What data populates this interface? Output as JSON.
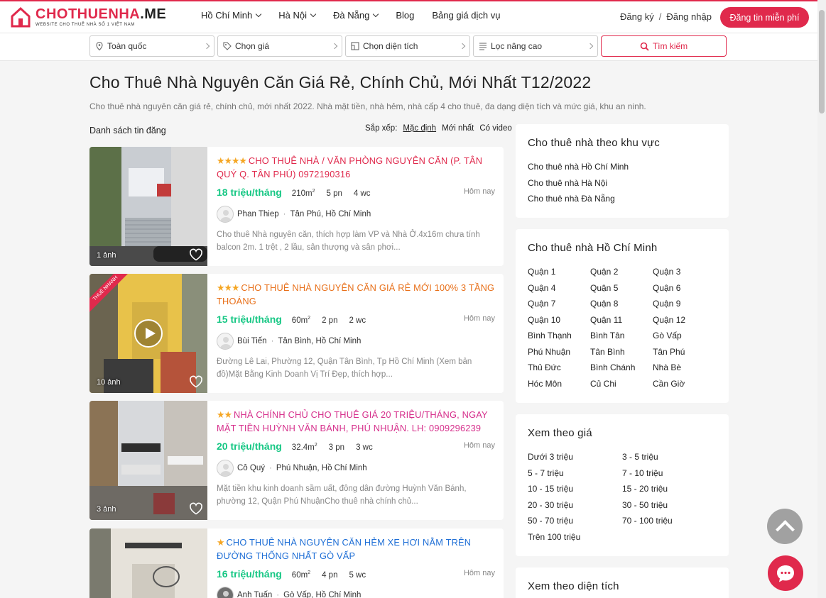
{
  "header": {
    "logo_name_red": "CHOTHUENHA",
    "logo_name_dark": ".ME",
    "logo_tagline": "WEBSITE CHO THUÊ NHÀ SỐ 1 VIỆT NAM",
    "nav": [
      {
        "label": "Hồ Chí Minh",
        "dropdown": true
      },
      {
        "label": "Hà Nội",
        "dropdown": true
      },
      {
        "label": "Đà Nẵng",
        "dropdown": true
      },
      {
        "label": "Blog",
        "dropdown": false
      },
      {
        "label": "Bảng giá dịch vụ",
        "dropdown": false
      }
    ],
    "register": "Đăng ký",
    "separator": "/",
    "login": "Đăng nhập",
    "post_button": "Đăng tin miễn phí",
    "brand_color": "#e0294c"
  },
  "search": {
    "location": "Toàn quốc",
    "price": "Chọn giá",
    "area": "Chọn diện tích",
    "advanced": "Lọc nâng cao",
    "button": "Tìm kiếm"
  },
  "page": {
    "title": "Cho Thuê Nhà Nguyên Căn Giá Rẻ, Chính Chủ, Mới Nhất T12/2022",
    "description": "Cho thuê nhà nguyên căn giá rẻ, chính chủ, mới nhất 2022. Nhà mặt tiền, nhà hẻm, nhà cấp 4 cho thuê, đa dạng diện tích và mức giá, khu an ninh.",
    "list_heading": "Danh sách tin đăng",
    "sort_label": "Sắp xếp:",
    "sort_options": [
      "Mặc định",
      "Mới nhất",
      "Có video"
    ]
  },
  "listings": [
    {
      "stars": "★★★★",
      "title": "CHO THUÊ NHÀ / VĂN PHÒNG NGUYÊN CĂN (P. TÂN QUÝ Q. TÂN PHÚ) 0972190316",
      "title_color": "#e0294c",
      "price": "18 triệu/tháng",
      "area_value": "210m",
      "area_unit": "2",
      "bedrooms": "5 pn",
      "bathrooms": "4 wc",
      "time": "Hôm nay",
      "author": "Phan Thiep",
      "location": "Tân Phú, Hồ Chí Minh",
      "excerpt": "Cho thuê Nhà nguyên căn, thích hợp làm VP và Nhà Ở.4x16m chưa tính balcon 2m. 1 trệt , 2 lầu, sân thượng và sân phơi...",
      "photos": "1 ảnh"
    },
    {
      "stars": "★★★",
      "title": "CHO THUÊ NHÀ NGUYÊN CĂN GIÁ RẺ MỚI 100% 3 TẦNG THOÁNG",
      "title_color": "#e8701a",
      "price": "15 triệu/tháng",
      "area_value": "60m",
      "area_unit": "2",
      "bedrooms": "2 pn",
      "bathrooms": "2 wc",
      "time": "Hôm nay",
      "author": "Bùi Tiến",
      "location": "Tân Bình, Hồ Chí Minh",
      "excerpt": "Đường Lê Lai, Phường 12, Quận Tân Bình, Tp Hồ Chí Minh (Xem bản đồ)Mặt Bằng Kinh Doanh Vị Trí Đẹp, thích hợp...",
      "photos": "10 ảnh",
      "badge": "THUÊ NHANH"
    },
    {
      "stars": "★★",
      "title": "NHÀ CHÍNH CHỦ CHO THUÊ GIÁ 20 TRIỆU/THÁNG, NGAY MẶT TIỀN HUỲNH VĂN BÁNH, PHÚ NHUẬN. LH: 0909296239",
      "title_color": "#d6308c",
      "price": "20 triệu/tháng",
      "area_value": "32.4m",
      "area_unit": "2",
      "bedrooms": "3 pn",
      "bathrooms": "3 wc",
      "time": "Hôm nay",
      "author": "Cô Quý",
      "location": "Phú Nhuận, Hồ Chí Minh",
      "excerpt": "Mặt tiền khu kinh doanh sầm uất, đông dân đường Huỳnh Văn Bánh, phường 12, Quận Phú NhuậnCho thuê nhà chính chủ...",
      "photos": "3 ảnh"
    },
    {
      "stars": "★",
      "title": "CHO THUÊ NHÀ NGUYÊN CĂN HẺM XE HƠI NẰM TRÊN ĐƯỜNG THỐNG NHẤT GÒ VẤP",
      "title_color": "#1f6fd6",
      "price": "16 triệu/tháng",
      "area_value": "60m",
      "area_unit": "2",
      "bedrooms": "4 pn",
      "bathrooms": "5 wc",
      "time": "Hôm nay",
      "author": "Anh Tuấn",
      "location": "Gò Vấp, Hồ Chí Minh",
      "excerpt": "",
      "photos": ""
    }
  ],
  "sidebar": {
    "by_region": {
      "title": "Cho thuê nhà theo khu vực",
      "items": [
        "Cho thuê nhà Hồ Chí Minh",
        "Cho thuê nhà Hà Nội",
        "Cho thuê nhà Đà Nẵng"
      ]
    },
    "hcm": {
      "title": "Cho thuê nhà Hồ Chí Minh",
      "items": [
        "Quận 1",
        "Quận 2",
        "Quận 3",
        "Quận 4",
        "Quận 5",
        "Quận 6",
        "Quận 7",
        "Quận 8",
        "Quận 9",
        "Quận 10",
        "Quận 11",
        "Quận 12",
        "Bình Thạnh",
        "Bình Tân",
        "Gò Vấp",
        "Phú Nhuận",
        "Tân Bình",
        "Tân Phú",
        "Thủ Đức",
        "Bình Chánh",
        "Nhà Bè",
        "Hóc Môn",
        "Củ Chi",
        "Cần Giờ"
      ]
    },
    "by_price": {
      "title": "Xem theo giá",
      "items": [
        "Dưới 3 triệu",
        "3 - 5 triệu",
        "5 - 7 triệu",
        "7 - 10 triệu",
        "10 - 15 triệu",
        "15 - 20 triệu",
        "20 - 30 triệu",
        "30 - 50 triệu",
        "50 - 70 triệu",
        "70 - 100 triệu",
        "Trên 100 triệu"
      ]
    },
    "by_area": {
      "title": "Xem theo diện tích"
    }
  }
}
